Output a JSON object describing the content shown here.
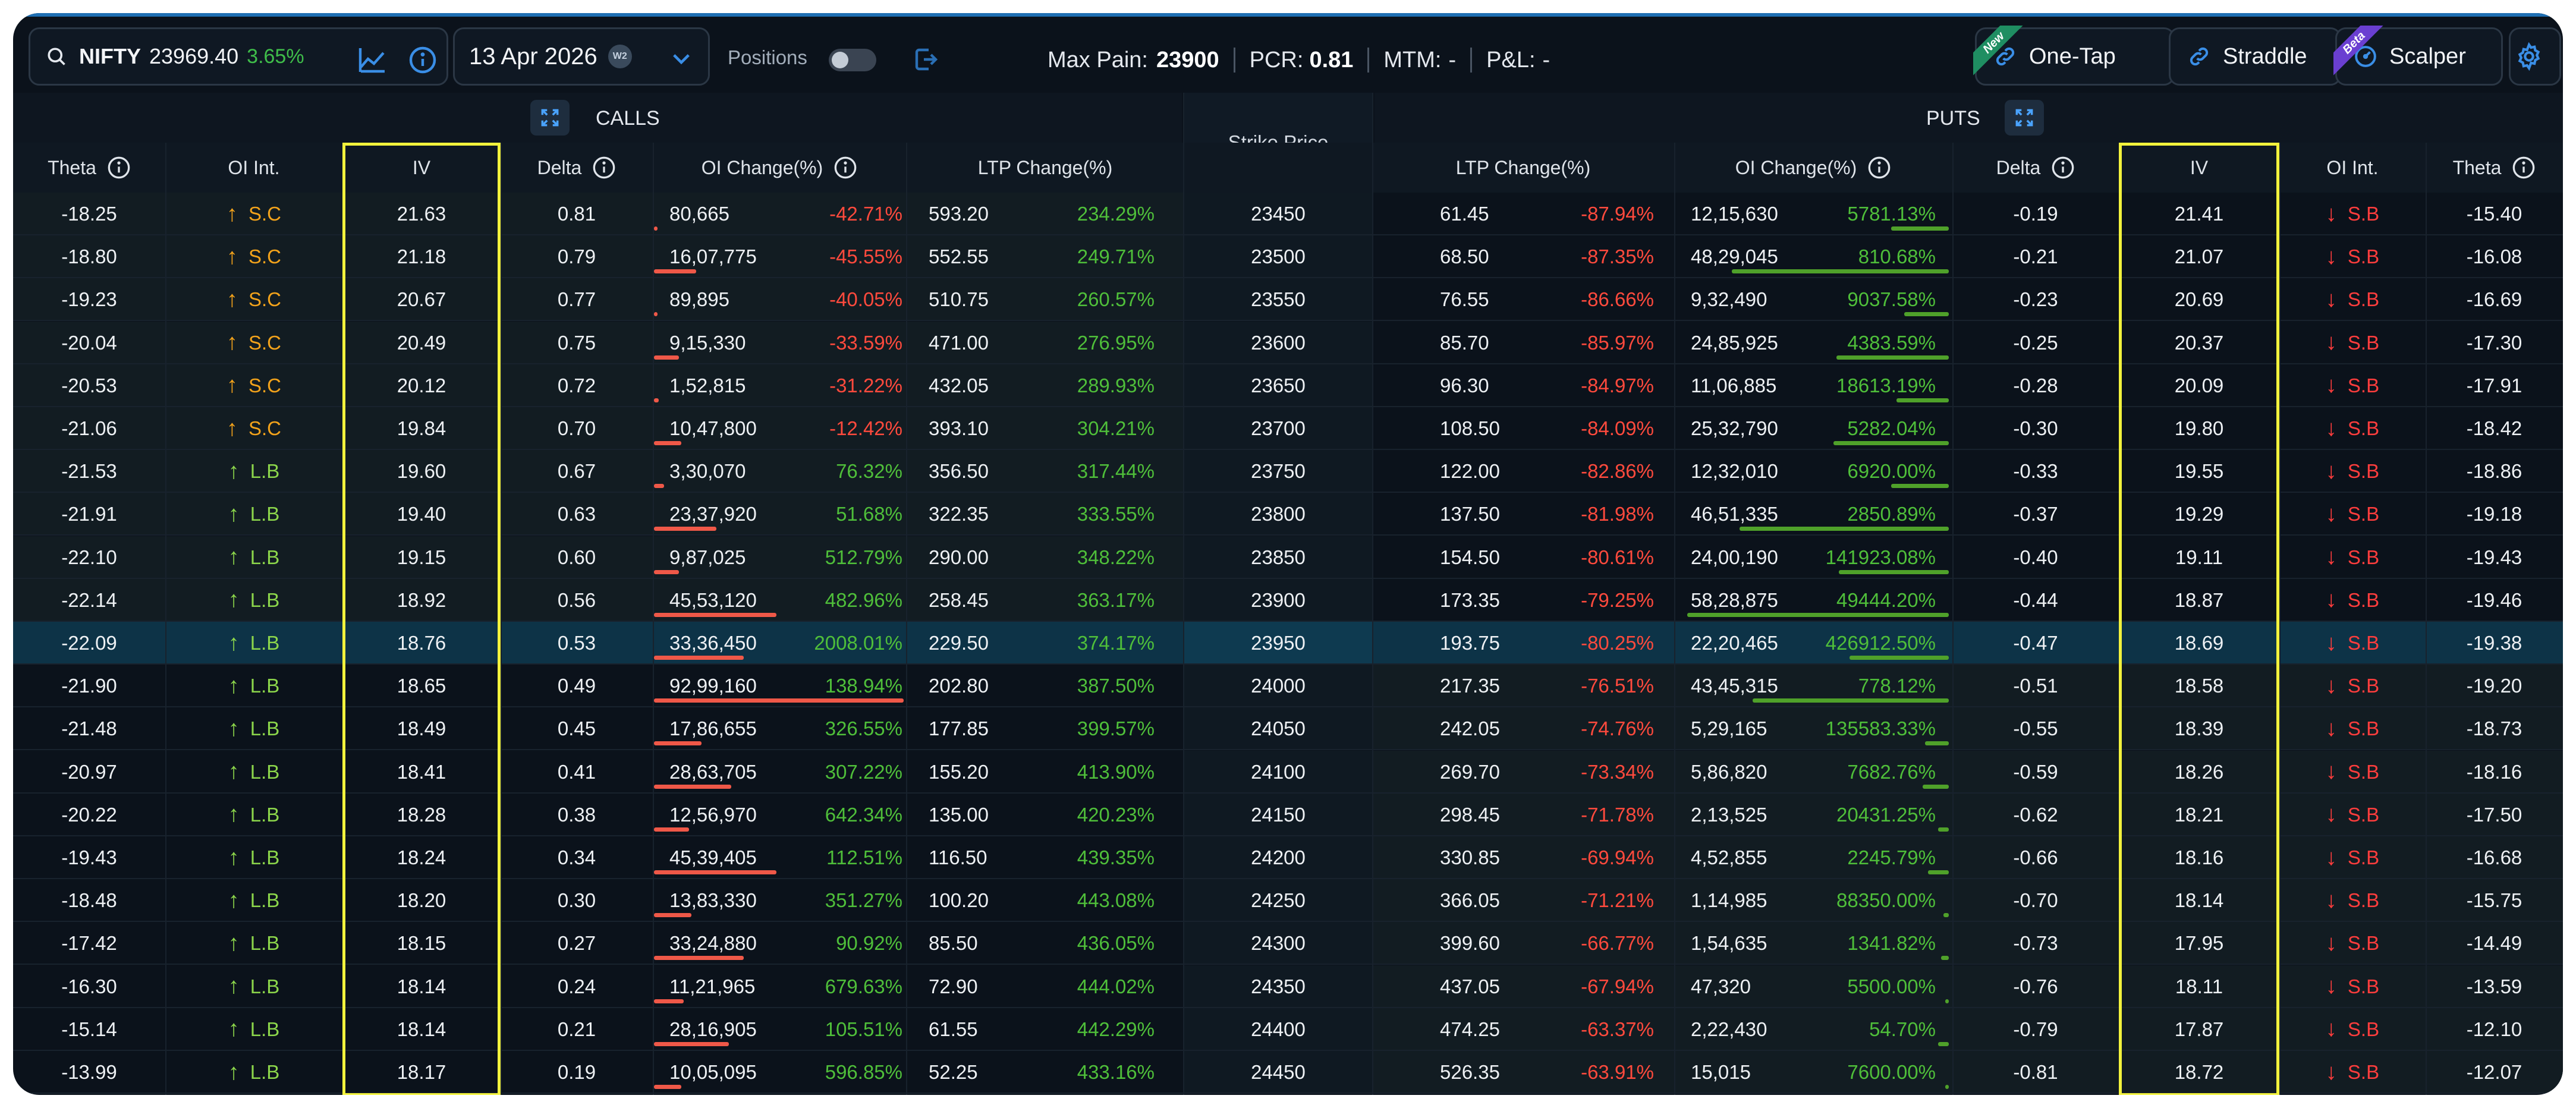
{
  "toolbar": {
    "symbol": "NIFTY",
    "spot": "23969.40",
    "change": "3.65%",
    "expiry": "13 Apr 2026",
    "expiry_badge": "W2",
    "positions_label": "Positions",
    "positions_on": false,
    "max_pain_label": "Max Pain:",
    "max_pain": "23900",
    "pcr_label": "PCR:",
    "pcr": "0.81",
    "mtm_label": "MTM:",
    "mtm": "-",
    "pnl_label": "P&L:",
    "pnl": "-",
    "one_tap": "One-Tap",
    "one_tap_badge": "New",
    "straddle": "Straddle",
    "scalper": "Scalper",
    "scalper_badge": "Beta"
  },
  "sections": {
    "calls": "CALLS",
    "puts": "PUTS",
    "strike": "Strike Price"
  },
  "columns": {
    "call_theta": "Theta",
    "call_oi_int": "OI Int.",
    "call_iv": "IV",
    "call_delta": "Delta",
    "call_oi_change": "OI Change(%)",
    "call_ltp_change": "LTP Change(%)",
    "put_ltp_change": "LTP Change(%)",
    "put_oi_change": "OI Change(%)",
    "put_delta": "Delta",
    "put_iv": "IV",
    "put_oi_int": "OI Int.",
    "put_theta": "Theta"
  },
  "colors": {
    "positive": "#4fbf3a",
    "negative": "#ff4a3d",
    "short_covering": "#f3a31b",
    "long_buildup": "#8cd64b",
    "short_buildup": "#ff3d3d",
    "iv_highlight": "#f2f23c",
    "atm_row": "#0d3347"
  },
  "rows": [
    {
      "strike": "23450",
      "atm": false,
      "call": {
        "theta": "-18.25",
        "oi_int": "S.C",
        "iv": "21.63",
        "delta": "0.81",
        "oi": "80,665",
        "oi_chg": "-42.71%",
        "oi_bar": 0.01,
        "ltp": "593.20",
        "ltp_chg": "234.29%"
      },
      "put": {
        "ltp": "61.45",
        "ltp_chg": "-87.94%",
        "oi": "12,15,630",
        "oi_chg": "5781.13%",
        "oi_bar": 0.22,
        "delta": "-0.19",
        "iv": "21.41",
        "oi_int": "S.B",
        "theta": "-15.40"
      }
    },
    {
      "strike": "23500",
      "atm": false,
      "call": {
        "theta": "-18.80",
        "oi_int": "S.C",
        "iv": "21.18",
        "delta": "0.79",
        "oi": "16,07,775",
        "oi_chg": "-45.55%",
        "oi_bar": 0.17,
        "ltp": "552.55",
        "ltp_chg": "249.71%"
      },
      "put": {
        "ltp": "68.50",
        "ltp_chg": "-87.35%",
        "oi": "48,29,045",
        "oi_chg": "810.68%",
        "oi_bar": 0.83,
        "delta": "-0.21",
        "iv": "21.07",
        "oi_int": "S.B",
        "theta": "-16.08"
      }
    },
    {
      "strike": "23550",
      "atm": false,
      "call": {
        "theta": "-19.23",
        "oi_int": "S.C",
        "iv": "20.67",
        "delta": "0.77",
        "oi": "89,895",
        "oi_chg": "-40.05%",
        "oi_bar": 0.01,
        "ltp": "510.75",
        "ltp_chg": "260.57%"
      },
      "put": {
        "ltp": "76.55",
        "ltp_chg": "-86.66%",
        "oi": "9,32,490",
        "oi_chg": "9037.58%",
        "oi_bar": 0.17,
        "delta": "-0.23",
        "iv": "20.69",
        "oi_int": "S.B",
        "theta": "-16.69"
      }
    },
    {
      "strike": "23600",
      "atm": false,
      "call": {
        "theta": "-20.04",
        "oi_int": "S.C",
        "iv": "20.49",
        "delta": "0.75",
        "oi": "9,15,330",
        "oi_chg": "-33.59%",
        "oi_bar": 0.1,
        "ltp": "471.00",
        "ltp_chg": "276.95%"
      },
      "put": {
        "ltp": "85.70",
        "ltp_chg": "-85.97%",
        "oi": "24,85,925",
        "oi_chg": "4383.59%",
        "oi_bar": 0.43,
        "delta": "-0.25",
        "iv": "20.37",
        "oi_int": "S.B",
        "theta": "-17.30"
      }
    },
    {
      "strike": "23650",
      "atm": false,
      "call": {
        "theta": "-20.53",
        "oi_int": "S.C",
        "iv": "20.12",
        "delta": "0.72",
        "oi": "1,52,815",
        "oi_chg": "-31.22%",
        "oi_bar": 0.02,
        "ltp": "432.05",
        "ltp_chg": "289.93%"
      },
      "put": {
        "ltp": "96.30",
        "ltp_chg": "-84.97%",
        "oi": "11,06,885",
        "oi_chg": "18613.19%",
        "oi_bar": 0.2,
        "delta": "-0.28",
        "iv": "20.09",
        "oi_int": "S.B",
        "theta": "-17.91"
      }
    },
    {
      "strike": "23700",
      "atm": false,
      "call": {
        "theta": "-21.06",
        "oi_int": "S.C",
        "iv": "19.84",
        "delta": "0.70",
        "oi": "10,47,800",
        "oi_chg": "-12.42%",
        "oi_bar": 0.11,
        "ltp": "393.10",
        "ltp_chg": "304.21%"
      },
      "put": {
        "ltp": "108.50",
        "ltp_chg": "-84.09%",
        "oi": "25,32,790",
        "oi_chg": "5282.04%",
        "oi_bar": 0.44,
        "delta": "-0.30",
        "iv": "19.80",
        "oi_int": "S.B",
        "theta": "-18.42"
      }
    },
    {
      "strike": "23750",
      "atm": false,
      "call": {
        "theta": "-21.53",
        "oi_int": "L.B",
        "iv": "19.60",
        "delta": "0.67",
        "oi": "3,30,070",
        "oi_chg": "76.32%",
        "oi_bar": 0.04,
        "ltp": "356.50",
        "ltp_chg": "317.44%"
      },
      "put": {
        "ltp": "122.00",
        "ltp_chg": "-82.86%",
        "oi": "12,32,010",
        "oi_chg": "6920.00%",
        "oi_bar": 0.22,
        "delta": "-0.33",
        "iv": "19.55",
        "oi_int": "S.B",
        "theta": "-18.86"
      }
    },
    {
      "strike": "23800",
      "atm": false,
      "call": {
        "theta": "-21.91",
        "oi_int": "L.B",
        "iv": "19.40",
        "delta": "0.63",
        "oi": "23,37,920",
        "oi_chg": "51.68%",
        "oi_bar": 0.25,
        "ltp": "322.35",
        "ltp_chg": "333.55%"
      },
      "put": {
        "ltp": "137.50",
        "ltp_chg": "-81.98%",
        "oi": "46,51,335",
        "oi_chg": "2850.89%",
        "oi_bar": 0.8,
        "delta": "-0.37",
        "iv": "19.29",
        "oi_int": "S.B",
        "theta": "-19.18"
      }
    },
    {
      "strike": "23850",
      "atm": false,
      "call": {
        "theta": "-22.10",
        "oi_int": "L.B",
        "iv": "19.15",
        "delta": "0.60",
        "oi": "9,87,025",
        "oi_chg": "512.79%",
        "oi_bar": 0.1,
        "ltp": "290.00",
        "ltp_chg": "348.22%"
      },
      "put": {
        "ltp": "154.50",
        "ltp_chg": "-80.61%",
        "oi": "24,00,190",
        "oi_chg": "141923.08%",
        "oi_bar": 0.42,
        "delta": "-0.40",
        "iv": "19.11",
        "oi_int": "S.B",
        "theta": "-19.43"
      }
    },
    {
      "strike": "23900",
      "atm": false,
      "call": {
        "theta": "-22.14",
        "oi_int": "L.B",
        "iv": "18.92",
        "delta": "0.56",
        "oi": "45,53,120",
        "oi_chg": "482.96%",
        "oi_bar": 0.49,
        "ltp": "258.45",
        "ltp_chg": "363.17%"
      },
      "put": {
        "ltp": "173.35",
        "ltp_chg": "-79.25%",
        "oi": "58,28,875",
        "oi_chg": "49444.20%",
        "oi_bar": 1.0,
        "delta": "-0.44",
        "iv": "18.87",
        "oi_int": "S.B",
        "theta": "-19.46"
      }
    },
    {
      "strike": "23950",
      "atm": true,
      "call": {
        "theta": "-22.09",
        "oi_int": "L.B",
        "iv": "18.76",
        "delta": "0.53",
        "oi": "33,36,450",
        "oi_chg": "2008.01%",
        "oi_bar": 0.36,
        "ltp": "229.50",
        "ltp_chg": "374.17%"
      },
      "put": {
        "ltp": "193.75",
        "ltp_chg": "-80.25%",
        "oi": "22,20,465",
        "oi_chg": "426912.50%",
        "oi_bar": 0.38,
        "delta": "-0.47",
        "iv": "18.69",
        "oi_int": "S.B",
        "theta": "-19.38"
      }
    },
    {
      "strike": "24000",
      "atm": false,
      "call": {
        "theta": "-21.90",
        "oi_int": "L.B",
        "iv": "18.65",
        "delta": "0.49",
        "oi": "92,99,160",
        "oi_chg": "138.94%",
        "oi_bar": 1.0,
        "ltp": "202.80",
        "ltp_chg": "387.50%"
      },
      "put": {
        "ltp": "217.35",
        "ltp_chg": "-76.51%",
        "oi": "43,45,315",
        "oi_chg": "778.12%",
        "oi_bar": 0.75,
        "delta": "-0.51",
        "iv": "18.58",
        "oi_int": "S.B",
        "theta": "-19.20"
      }
    },
    {
      "strike": "24050",
      "atm": false,
      "call": {
        "theta": "-21.48",
        "oi_int": "L.B",
        "iv": "18.49",
        "delta": "0.45",
        "oi": "17,86,655",
        "oi_chg": "326.55%",
        "oi_bar": 0.19,
        "ltp": "177.85",
        "ltp_chg": "399.57%"
      },
      "put": {
        "ltp": "242.05",
        "ltp_chg": "-74.76%",
        "oi": "5,29,165",
        "oi_chg": "135583.33%",
        "oi_bar": 0.09,
        "delta": "-0.55",
        "iv": "18.39",
        "oi_int": "S.B",
        "theta": "-18.73"
      }
    },
    {
      "strike": "24100",
      "atm": false,
      "call": {
        "theta": "-20.97",
        "oi_int": "L.B",
        "iv": "18.41",
        "delta": "0.41",
        "oi": "28,63,705",
        "oi_chg": "307.22%",
        "oi_bar": 0.31,
        "ltp": "155.20",
        "ltp_chg": "413.90%"
      },
      "put": {
        "ltp": "269.70",
        "ltp_chg": "-73.34%",
        "oi": "5,86,820",
        "oi_chg": "7682.76%",
        "oi_bar": 0.1,
        "delta": "-0.59",
        "iv": "18.26",
        "oi_int": "S.B",
        "theta": "-18.16"
      }
    },
    {
      "strike": "24150",
      "atm": false,
      "call": {
        "theta": "-20.22",
        "oi_int": "L.B",
        "iv": "18.28",
        "delta": "0.38",
        "oi": "12,56,970",
        "oi_chg": "642.34%",
        "oi_bar": 0.14,
        "ltp": "135.00",
        "ltp_chg": "420.23%"
      },
      "put": {
        "ltp": "298.45",
        "ltp_chg": "-71.78%",
        "oi": "2,13,525",
        "oi_chg": "20431.25%",
        "oi_bar": 0.04,
        "delta": "-0.62",
        "iv": "18.21",
        "oi_int": "S.B",
        "theta": "-17.50"
      }
    },
    {
      "strike": "24200",
      "atm": false,
      "call": {
        "theta": "-19.43",
        "oi_int": "L.B",
        "iv": "18.24",
        "delta": "0.34",
        "oi": "45,39,405",
        "oi_chg": "112.51%",
        "oi_bar": 0.49,
        "ltp": "116.50",
        "ltp_chg": "439.35%"
      },
      "put": {
        "ltp": "330.85",
        "ltp_chg": "-69.94%",
        "oi": "4,52,855",
        "oi_chg": "2245.79%",
        "oi_bar": 0.08,
        "delta": "-0.66",
        "iv": "18.16",
        "oi_int": "S.B",
        "theta": "-16.68"
      }
    },
    {
      "strike": "24250",
      "atm": false,
      "call": {
        "theta": "-18.48",
        "oi_int": "L.B",
        "iv": "18.20",
        "delta": "0.30",
        "oi": "13,83,330",
        "oi_chg": "351.27%",
        "oi_bar": 0.15,
        "ltp": "100.20",
        "ltp_chg": "443.08%"
      },
      "put": {
        "ltp": "366.05",
        "ltp_chg": "-71.21%",
        "oi": "1,14,985",
        "oi_chg": "88350.00%",
        "oi_bar": 0.02,
        "delta": "-0.70",
        "iv": "18.14",
        "oi_int": "S.B",
        "theta": "-15.75"
      }
    },
    {
      "strike": "24300",
      "atm": false,
      "call": {
        "theta": "-17.42",
        "oi_int": "L.B",
        "iv": "18.15",
        "delta": "0.27",
        "oi": "33,24,880",
        "oi_chg": "90.92%",
        "oi_bar": 0.36,
        "ltp": "85.50",
        "ltp_chg": "436.05%"
      },
      "put": {
        "ltp": "399.60",
        "ltp_chg": "-66.77%",
        "oi": "1,54,635",
        "oi_chg": "1341.82%",
        "oi_bar": 0.03,
        "delta": "-0.73",
        "iv": "17.95",
        "oi_int": "S.B",
        "theta": "-14.49"
      }
    },
    {
      "strike": "24350",
      "atm": false,
      "call": {
        "theta": "-16.30",
        "oi_int": "L.B",
        "iv": "18.14",
        "delta": "0.24",
        "oi": "11,21,965",
        "oi_chg": "679.63%",
        "oi_bar": 0.12,
        "ltp": "72.90",
        "ltp_chg": "444.02%"
      },
      "put": {
        "ltp": "437.05",
        "ltp_chg": "-67.94%",
        "oi": "47,320",
        "oi_chg": "5500.00%",
        "oi_bar": 0.01,
        "delta": "-0.76",
        "iv": "18.11",
        "oi_int": "S.B",
        "theta": "-13.59"
      }
    },
    {
      "strike": "24400",
      "atm": false,
      "call": {
        "theta": "-15.14",
        "oi_int": "L.B",
        "iv": "18.14",
        "delta": "0.21",
        "oi": "28,16,905",
        "oi_chg": "105.51%",
        "oi_bar": 0.3,
        "ltp": "61.55",
        "ltp_chg": "442.29%"
      },
      "put": {
        "ltp": "474.25",
        "ltp_chg": "-63.37%",
        "oi": "2,22,430",
        "oi_chg": "54.70%",
        "oi_bar": 0.04,
        "delta": "-0.79",
        "iv": "17.87",
        "oi_int": "S.B",
        "theta": "-12.10"
      }
    },
    {
      "strike": "24450",
      "atm": false,
      "call": {
        "theta": "-13.99",
        "oi_int": "L.B",
        "iv": "18.17",
        "delta": "0.19",
        "oi": "10,05,095",
        "oi_chg": "596.85%",
        "oi_bar": 0.11,
        "ltp": "52.25",
        "ltp_chg": "433.16%"
      },
      "put": {
        "ltp": "526.35",
        "ltp_chg": "-63.91%",
        "oi": "15,015",
        "oi_chg": "7600.00%",
        "oi_bar": 0.01,
        "delta": "-0.81",
        "iv": "18.72",
        "oi_int": "S.B",
        "theta": "-12.07"
      }
    }
  ]
}
